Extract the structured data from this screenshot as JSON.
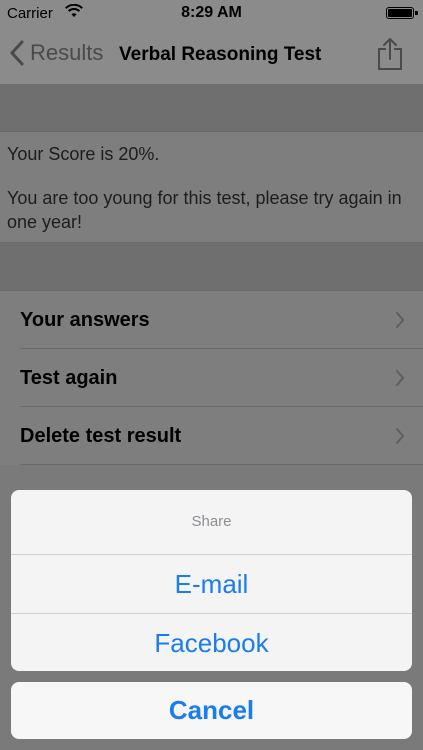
{
  "status_bar": {
    "carrier": "Carrier",
    "time": "8:29 AM"
  },
  "nav_bar": {
    "back_label": "Results",
    "title": "Verbal Reasoning Test"
  },
  "result": {
    "score_text": "Your Score is 20%.",
    "message": "You are too young for this test, please try again in one year!"
  },
  "menu": {
    "items": [
      {
        "label": "Your answers"
      },
      {
        "label": "Test again"
      },
      {
        "label": "Delete test result"
      }
    ]
  },
  "action_sheet": {
    "title": "Share",
    "options": [
      {
        "label": "E-mail"
      },
      {
        "label": "Facebook"
      }
    ],
    "cancel_label": "Cancel"
  },
  "colors": {
    "accent": "#1a7cf0"
  }
}
